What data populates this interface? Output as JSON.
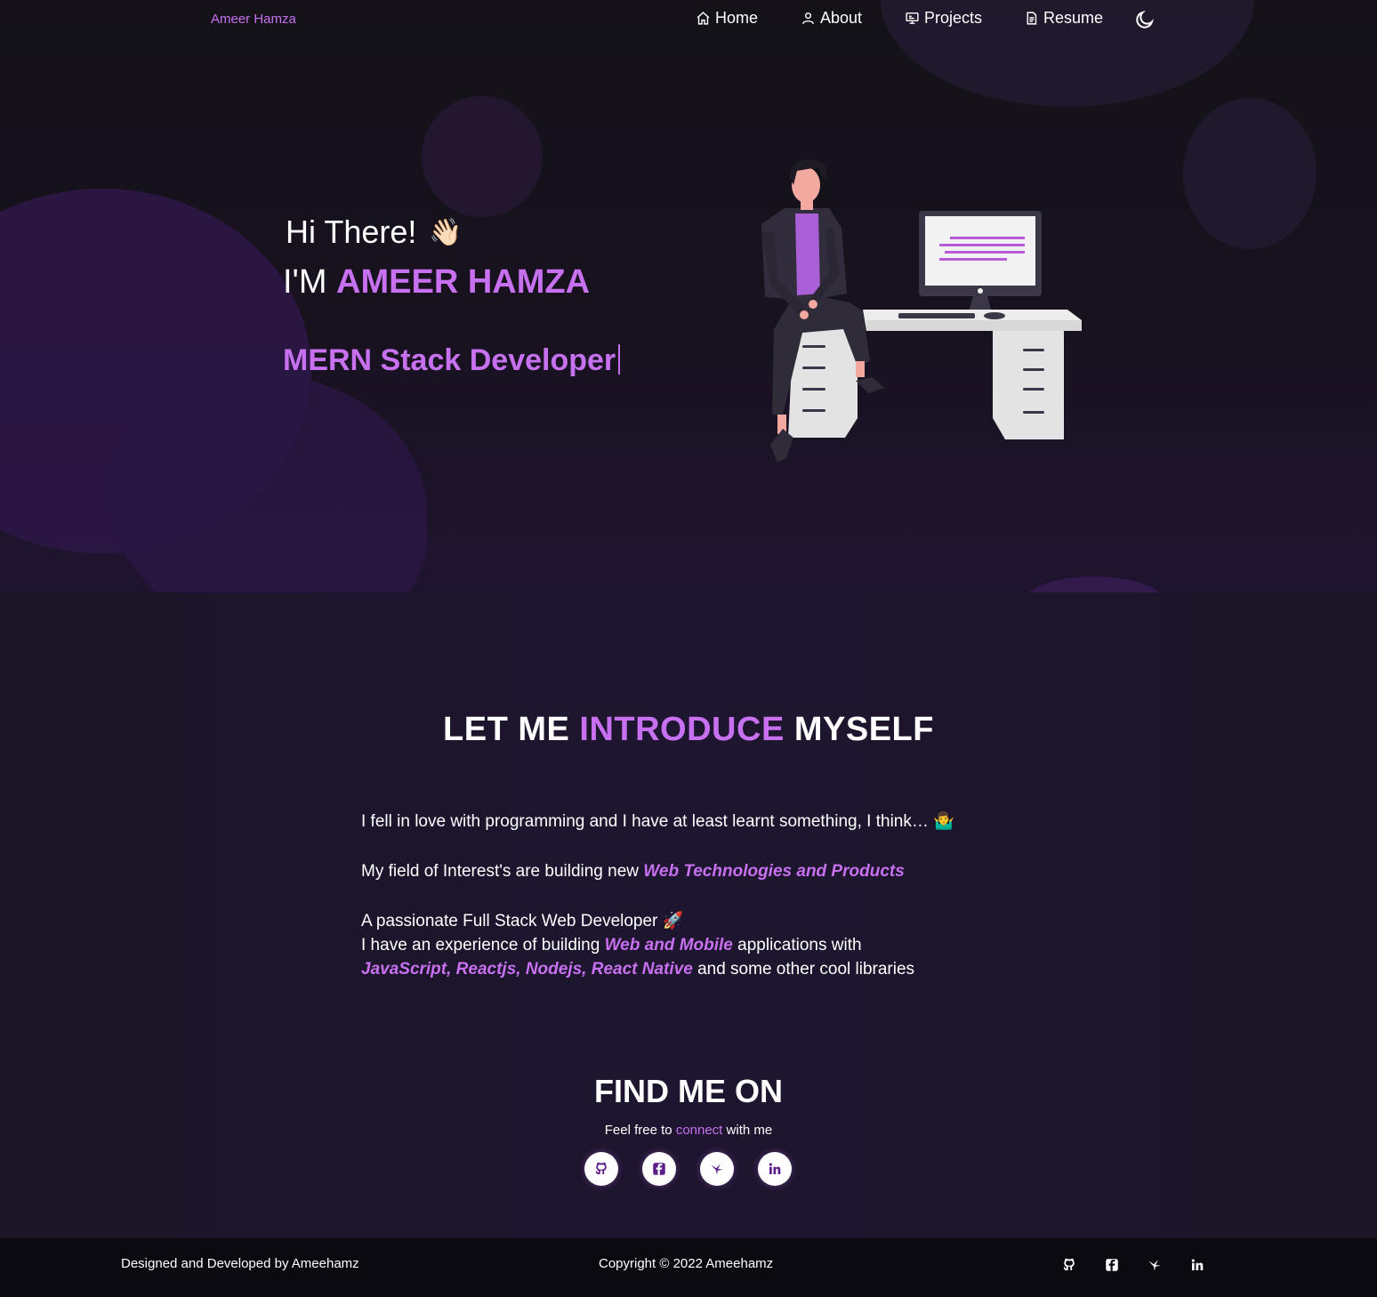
{
  "nav": {
    "brand": "Ameer Hamza",
    "items": [
      {
        "label": "Home",
        "icon": "home-icon"
      },
      {
        "label": "About",
        "icon": "user-icon"
      },
      {
        "label": "Projects",
        "icon": "projects-icon"
      },
      {
        "label": "Resume",
        "icon": "document-icon"
      }
    ],
    "theme_icon": "moon-icon"
  },
  "hero": {
    "greeting": "Hi There!",
    "wave": "👋🏻",
    "name_prefix": "I'M",
    "name": "AMEER HAMZA",
    "role": "MERN Stack Developer"
  },
  "about": {
    "title_a": "LET ME",
    "title_b": "INTRODUCE",
    "title_c": "MYSELF",
    "p1": "I fell in love with programming and I have at least learnt something, I think…",
    "p1_emoji": "🤷‍♂️",
    "p2_text": "My field of Interest's are building new",
    "p2_em": "Web Technologies and Products",
    "p3_line1": "A passionate Full Stack Web Developer",
    "p3_emoji": "🚀",
    "p3_line2a": "I have an experience of building",
    "p3_line2_em": "Web and Mobile",
    "p3_line2b": "applications with",
    "p3_line3_em": "JavaScript, Reactjs, Nodejs, React Native",
    "p3_line3b": "and some other cool libraries"
  },
  "find": {
    "title": "FIND ME ON",
    "sub_a": "Feel free to",
    "sub_link": "connect",
    "sub_b": "with me",
    "socials": [
      "github-icon",
      "facebook-icon",
      "hackerrank-icon",
      "linkedin-icon"
    ]
  },
  "footer": {
    "left": "Designed and Developed by Ameehamz",
    "copyright": "Copyright © 2022 Ameehamz"
  },
  "colors": {
    "accent": "#c770f0",
    "background": "#1a1420",
    "footer": "#0b0a10"
  }
}
